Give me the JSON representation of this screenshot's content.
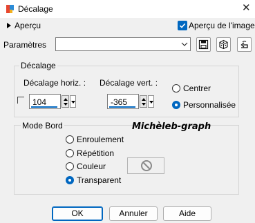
{
  "window": {
    "title": "Décalage",
    "close_glyph": "✕"
  },
  "preview": {
    "label": "Aperçu",
    "checkbox_label": "Aperçu de l'image",
    "checked": true
  },
  "params": {
    "label": "Paramètres",
    "combo_value": ""
  },
  "toolbar": {
    "icons": [
      "save-preset-icon",
      "random-dice-icon",
      "reset-icon"
    ]
  },
  "offset": {
    "group_label": "Décalage",
    "horiz_label": "Décalage horiz. :",
    "horiz_value": "104",
    "vert_label": "Décalage vert. :",
    "vert_value": "-365",
    "mode_options": [
      {
        "label": "Centrer",
        "selected": false
      },
      {
        "label": "Personnalisée",
        "selected": true
      }
    ]
  },
  "edge": {
    "group_label": "Mode Bord",
    "options": [
      {
        "label": "Enroulement",
        "selected": false
      },
      {
        "label": "Répétition",
        "selected": false
      },
      {
        "label": "Couleur",
        "selected": false
      },
      {
        "label": "Transparent",
        "selected": true
      }
    ]
  },
  "watermark": "Michèleb-graph",
  "buttons": {
    "ok": "OK",
    "cancel": "Annuler",
    "help": "Aide"
  },
  "colors": {
    "accent": "#0067c0",
    "background": "#f0f0f0"
  }
}
